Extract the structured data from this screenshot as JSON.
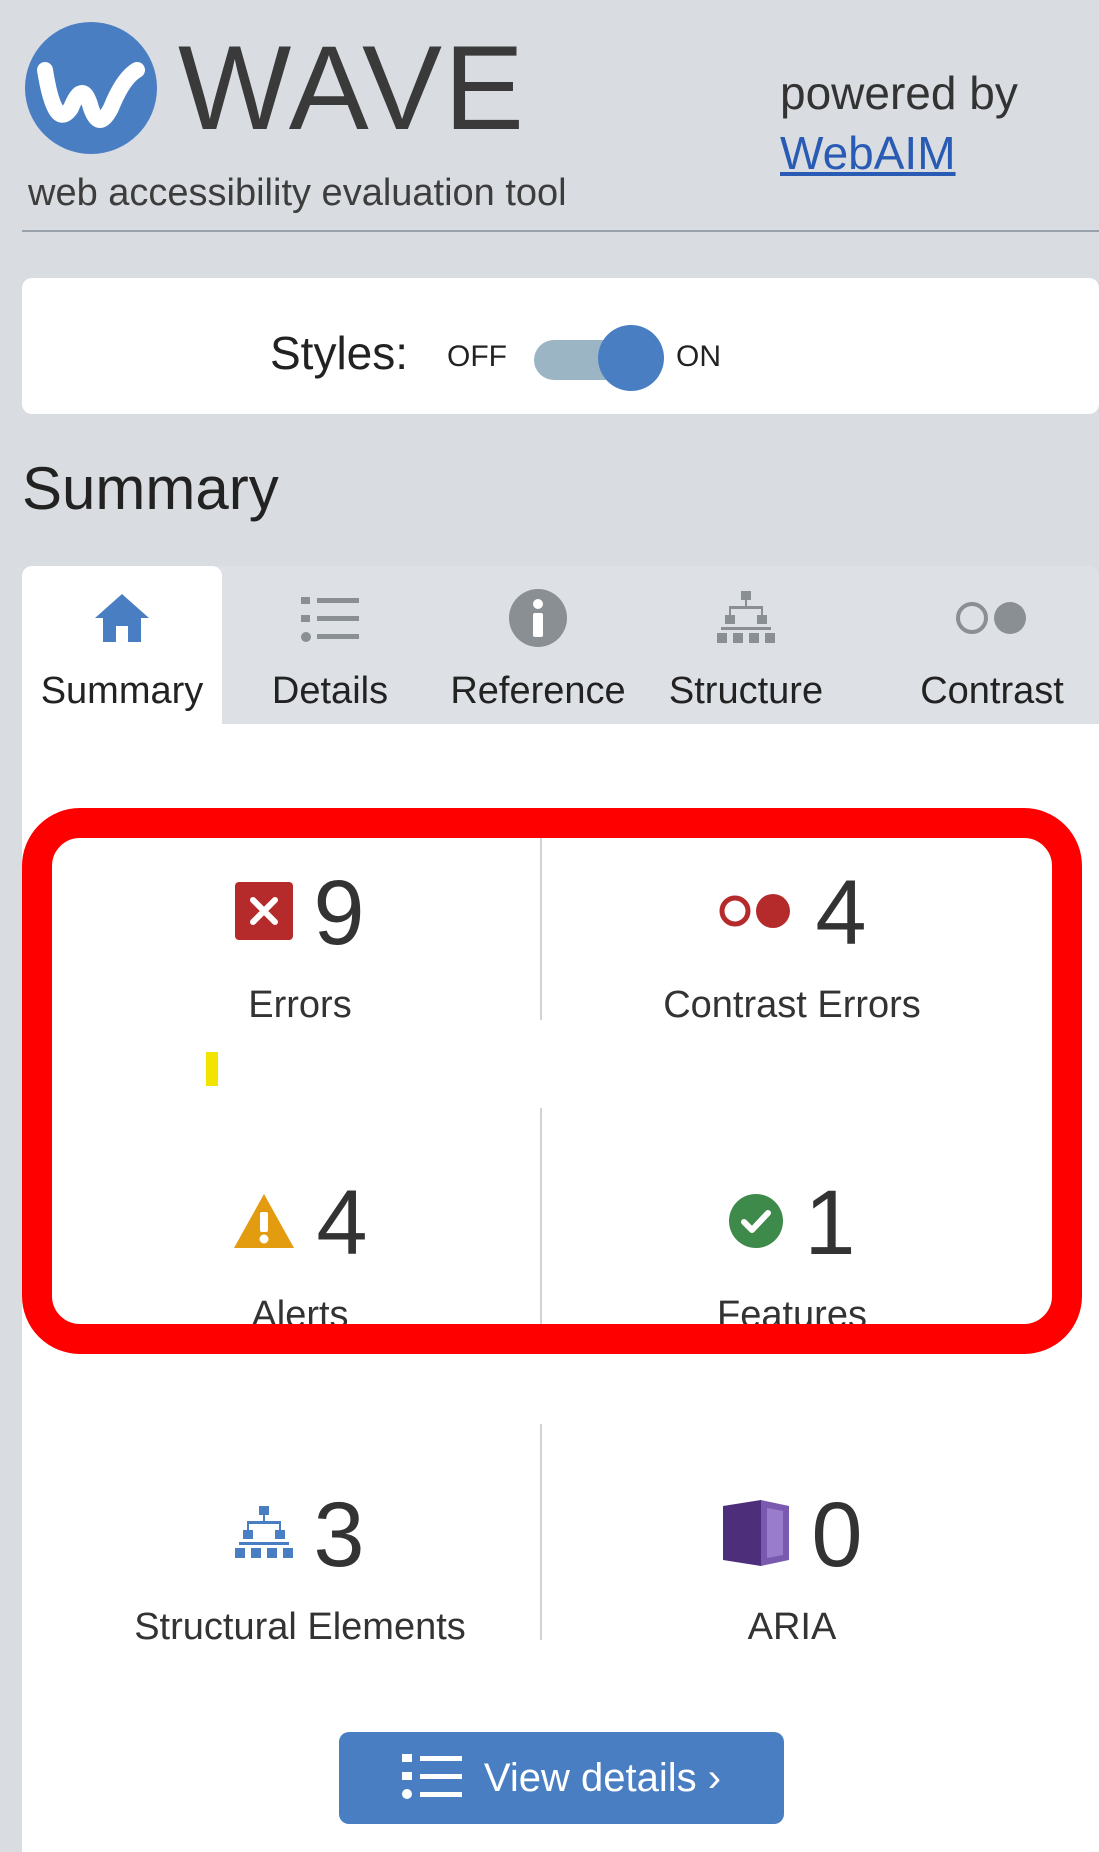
{
  "header": {
    "app_title": "WAVE",
    "subtitle": "web accessibility evaluation tool",
    "powered_by": "powered by",
    "link_text": "WebAIM"
  },
  "styles_toggle": {
    "label": "Styles:",
    "off": "OFF",
    "on": "ON",
    "state": "on"
  },
  "summary_heading": "Summary",
  "tabs": [
    {
      "label": "Summary",
      "icon": "home-icon",
      "active": true
    },
    {
      "label": "Details",
      "icon": "list-icon",
      "active": false
    },
    {
      "label": "Reference",
      "icon": "info-icon",
      "active": false
    },
    {
      "label": "Structure",
      "icon": "hierarchy-icon",
      "active": false
    },
    {
      "label": "Contrast",
      "icon": "contrast-icon",
      "active": false
    }
  ],
  "stats": {
    "errors": {
      "count": "9",
      "label": "Errors",
      "icon": "error-x-icon"
    },
    "contrast_errors": {
      "count": "4",
      "label": "Contrast Errors",
      "icon": "contrast-error-icon"
    },
    "alerts": {
      "count": "4",
      "label": "Alerts",
      "icon": "alert-triangle-icon"
    },
    "features": {
      "count": "1",
      "label": "Features",
      "icon": "check-circle-icon"
    },
    "structural": {
      "count": "3",
      "label": "Structural Elements",
      "icon": "hierarchy-icon"
    },
    "aria": {
      "count": "0",
      "label": "ARIA",
      "icon": "aria-cube-icon"
    }
  },
  "view_details": {
    "label": "View details ›",
    "icon": "list-icon"
  },
  "colors": {
    "brand_blue": "#4a7ec3",
    "error_red": "#b52a2a",
    "alert_orange": "#e39b10",
    "feature_green": "#3e8a4a",
    "aria_purple": "#4d2e7a",
    "highlight_red": "#ff0000"
  }
}
